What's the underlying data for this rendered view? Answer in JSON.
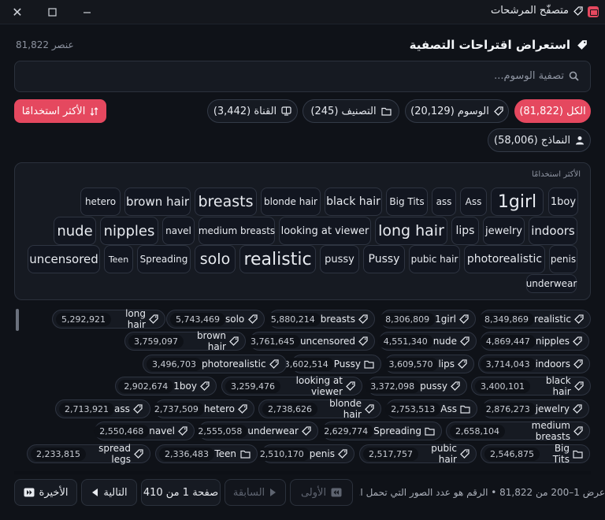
{
  "window": {
    "title": "متصفّح المرشحات"
  },
  "header": {
    "title": "استعراض اقتراحات التصفية",
    "count": "81,822 عنصر"
  },
  "search": {
    "placeholder": "تصفية الوسوم..."
  },
  "filters": [
    {
      "label": "الكل (81,822)",
      "icon": "none",
      "active": true
    },
    {
      "label": "الوسوم (20,129)",
      "icon": "tag-icon",
      "active": false
    },
    {
      "label": "التصنيف (245)",
      "icon": "folder-icon",
      "active": false
    },
    {
      "label": "القناة (3,442)",
      "icon": "channel-icon",
      "active": false
    },
    {
      "label": "النماذج (58,006)",
      "icon": "person-icon",
      "active": false
    }
  ],
  "sort": {
    "label": "الأكثر استخدامًا",
    "icon": "sort-icon"
  },
  "cloud": {
    "title": "الأكثر استخدامًا",
    "rows": [
      [
        "1boy",
        "1girl",
        "Ass",
        "ass",
        "Big Tits",
        "black hair",
        "blonde hair",
        "breasts",
        "brown hair",
        "hetero"
      ],
      [
        "indoors",
        "jewelry",
        "lips",
        "long hair",
        "looking at viewer",
        "medium breasts",
        "navel",
        "nipples",
        "nude"
      ],
      [
        "penis",
        "photorealistic",
        "pubic hair",
        "Pussy",
        "pussy",
        "realistic",
        "solo",
        "Spreading",
        "Teen",
        "uncensored"
      ],
      [
        "underwear"
      ]
    ]
  },
  "list": {
    "rows": [
      [
        {
          "name": "realistic",
          "count": "8,349,869",
          "icon": "tag-icon"
        },
        {
          "name": "1girl",
          "count": "8,306,809",
          "icon": "tag-icon"
        },
        {
          "name": "breasts",
          "count": "5,880,214",
          "icon": "tag-icon"
        },
        {
          "name": "solo",
          "count": "5,743,469",
          "icon": "tag-icon"
        },
        {
          "name": "long hair",
          "count": "5,292,921",
          "icon": "tag-icon"
        }
      ],
      [
        {
          "name": "nipples",
          "count": "4,869,447",
          "icon": "tag-icon"
        },
        {
          "name": "nude",
          "count": "4,551,340",
          "icon": "tag-icon"
        },
        {
          "name": "uncensored",
          "count": "3,761,645",
          "icon": "tag-icon"
        },
        {
          "name": "brown hair",
          "count": "3,759,097",
          "icon": "tag-icon"
        }
      ],
      [
        {
          "name": "indoors",
          "count": "3,714,043",
          "icon": "tag-icon"
        },
        {
          "name": "lips",
          "count": "3,609,570",
          "icon": "tag-icon"
        },
        {
          "name": "Pussy",
          "count": "3,602,514",
          "icon": "folder-icon"
        },
        {
          "name": "photorealistic",
          "count": "3,496,703",
          "icon": "tag-icon"
        }
      ],
      [
        {
          "name": "black hair",
          "count": "3,400,101",
          "icon": "tag-icon"
        },
        {
          "name": "pussy",
          "count": "3,372,098",
          "icon": "tag-icon"
        },
        {
          "name": "looking at viewer",
          "count": "3,259,476",
          "icon": "tag-icon"
        },
        {
          "name": "1boy",
          "count": "2,902,674",
          "icon": "tag-icon"
        }
      ],
      [
        {
          "name": "jewelry",
          "count": "2,876,273",
          "icon": "tag-icon"
        },
        {
          "name": "Ass",
          "count": "2,753,513",
          "icon": "folder-icon"
        },
        {
          "name": "blonde hair",
          "count": "2,738,626",
          "icon": "tag-icon"
        },
        {
          "name": "hetero",
          "count": "2,737,509",
          "icon": "tag-icon"
        },
        {
          "name": "ass",
          "count": "2,713,921",
          "icon": "tag-icon"
        }
      ],
      [
        {
          "name": "medium breasts",
          "count": "2,658,104",
          "icon": "tag-icon"
        },
        {
          "name": "Spreading",
          "count": "2,629,774",
          "icon": "folder-icon"
        },
        {
          "name": "underwear",
          "count": "2,555,058",
          "icon": "tag-icon"
        },
        {
          "name": "navel",
          "count": "2,550,468",
          "icon": "tag-icon"
        }
      ],
      [
        {
          "name": "Big Tits",
          "count": "2,546,875",
          "icon": "folder-icon"
        },
        {
          "name": "pubic hair",
          "count": "2,517,757",
          "icon": "tag-icon"
        },
        {
          "name": "penis",
          "count": "2,510,170",
          "icon": "tag-icon"
        },
        {
          "name": "Teen",
          "count": "2,336,483",
          "icon": "folder-icon"
        },
        {
          "name": "spread legs",
          "count": "2,233,815",
          "icon": "tag-icon"
        }
      ]
    ]
  },
  "footer": {
    "status": "عرض 1–200 من 81,822  •  الرقم هو عدد الصور التي تحمل ا...",
    "first": "الأولى",
    "prev": "السابقة",
    "page": "صفحة 1 من 410",
    "next": "التالية",
    "last": "الأخيرة"
  },
  "colors": {
    "accent": "#e5485f",
    "background": "#0f1218",
    "panel": "#161a22",
    "border": "#2b313c"
  }
}
